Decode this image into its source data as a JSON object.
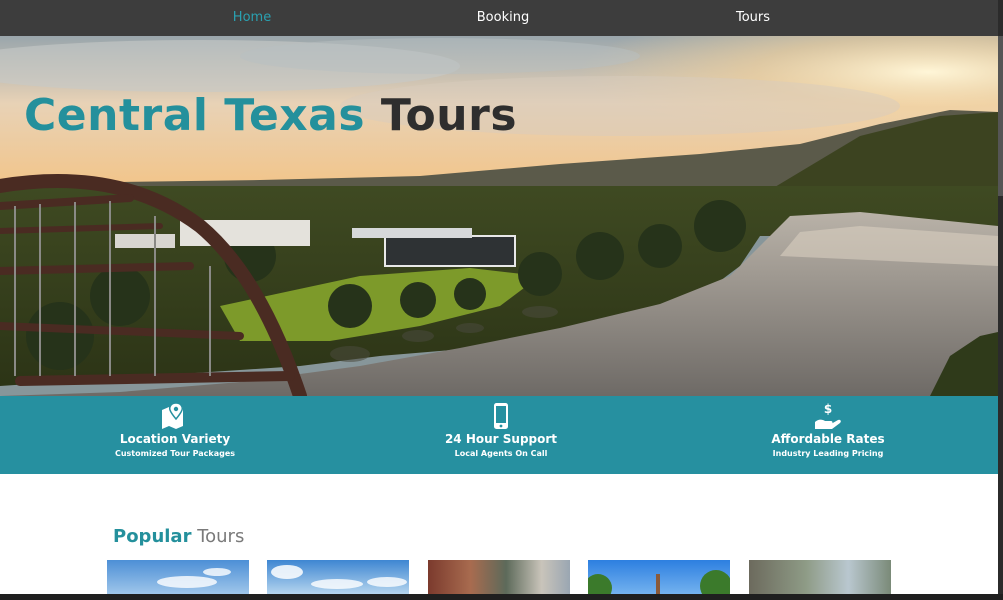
{
  "nav": {
    "items": [
      {
        "label": "Home",
        "active": true
      },
      {
        "label": "Booking",
        "active": false
      },
      {
        "label": "Tours",
        "active": false
      }
    ]
  },
  "hero": {
    "title_part1": "Central Texas",
    "title_part2": "Tours"
  },
  "features": [
    {
      "icon": "map-location-icon",
      "title": "Location Variety",
      "subtitle": "Customized Tour Packages"
    },
    {
      "icon": "mobile-phone-icon",
      "title": "24 Hour Support",
      "subtitle": "Local Agents On Call"
    },
    {
      "icon": "dollar-hand-icon",
      "title": "Affordable Rates",
      "subtitle": "Industry Leading Pricing"
    }
  ],
  "popular": {
    "heading_part1": "Popular",
    "heading_part2": "Tours"
  },
  "colors": {
    "nav_bg": "#3d3d3d",
    "accent": "#2690a0",
    "title_teal": "#24909c",
    "title_dark": "#2e2e2e"
  }
}
